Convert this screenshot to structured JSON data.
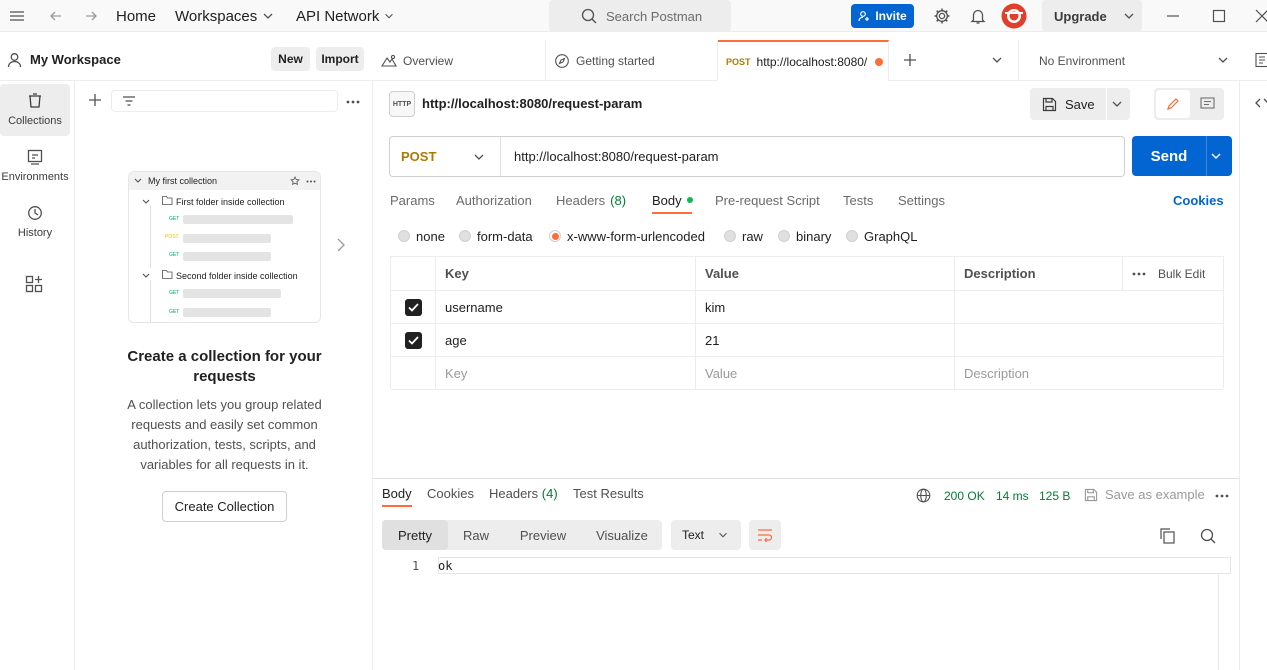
{
  "topbar": {
    "nav_home": "Home",
    "nav_workspaces": "Workspaces",
    "nav_api_network": "API Network",
    "search_placeholder": "Search Postman",
    "invite_label": "Invite",
    "upgrade_label": "Upgrade"
  },
  "workspace": {
    "name": "My Workspace",
    "new_label": "New",
    "import_label": "Import"
  },
  "rail": [
    {
      "label": "Collections",
      "icon": "trash-box-icon"
    },
    {
      "label": "Environments",
      "icon": "environment-icon"
    },
    {
      "label": "History",
      "icon": "history-icon"
    }
  ],
  "collections_panel": {
    "illustration": {
      "collection": "My first collection",
      "folder1": "First folder inside collection",
      "folder2": "Second folder inside collection",
      "methods": [
        "GET",
        "POST",
        "GET",
        "GET",
        "GET"
      ]
    },
    "heading": "Create a collection for your requests",
    "description": "A collection lets you group related requests and easily set common authorization, tests, scripts, and variables for all requests in it.",
    "create_button": "Create Collection"
  },
  "tabs": {
    "overview": "Overview",
    "getting_started": "Getting started",
    "active_method": "POST",
    "active_url": "http://localhost:8080/",
    "environment": "No Environment"
  },
  "request": {
    "http_badge": "HTTP",
    "title": "http://localhost:8080/request-param",
    "save_label": "Save",
    "method": "POST",
    "url": "http://localhost:8080/request-param",
    "send_label": "Send",
    "tabs": [
      "Params",
      "Authorization",
      "Headers",
      "Body",
      "Pre-request Script",
      "Tests",
      "Settings"
    ],
    "headers_count": "(8)",
    "cookies_label": "Cookies",
    "body_types": [
      "none",
      "form-data",
      "x-www-form-urlencoded",
      "raw",
      "binary",
      "GraphQL"
    ],
    "selected_body_type": "x-www-form-urlencoded",
    "table": {
      "headers": [
        "Key",
        "Value",
        "Description"
      ],
      "bulk_edit": "Bulk Edit",
      "rows": [
        {
          "key": "username",
          "value": "kim",
          "description": ""
        },
        {
          "key": "age",
          "value": "21",
          "description": ""
        }
      ],
      "placeholder": {
        "key": "Key",
        "value": "Value",
        "description": "Description"
      }
    }
  },
  "response": {
    "tabs": [
      "Body",
      "Cookies",
      "Headers",
      "Test Results"
    ],
    "headers_count": "(4)",
    "status": "200 OK",
    "time": "14 ms",
    "size": "125 B",
    "save_example": "Save as example",
    "view_modes": [
      "Pretty",
      "Raw",
      "Preview",
      "Visualize"
    ],
    "format": "Text",
    "lines": [
      {
        "number": "1",
        "text": "ok"
      }
    ]
  },
  "colors": {
    "accent": "#0265d2",
    "post": "#ad7a03",
    "orange": "#ff6c37",
    "status_ok": "#007f31"
  }
}
